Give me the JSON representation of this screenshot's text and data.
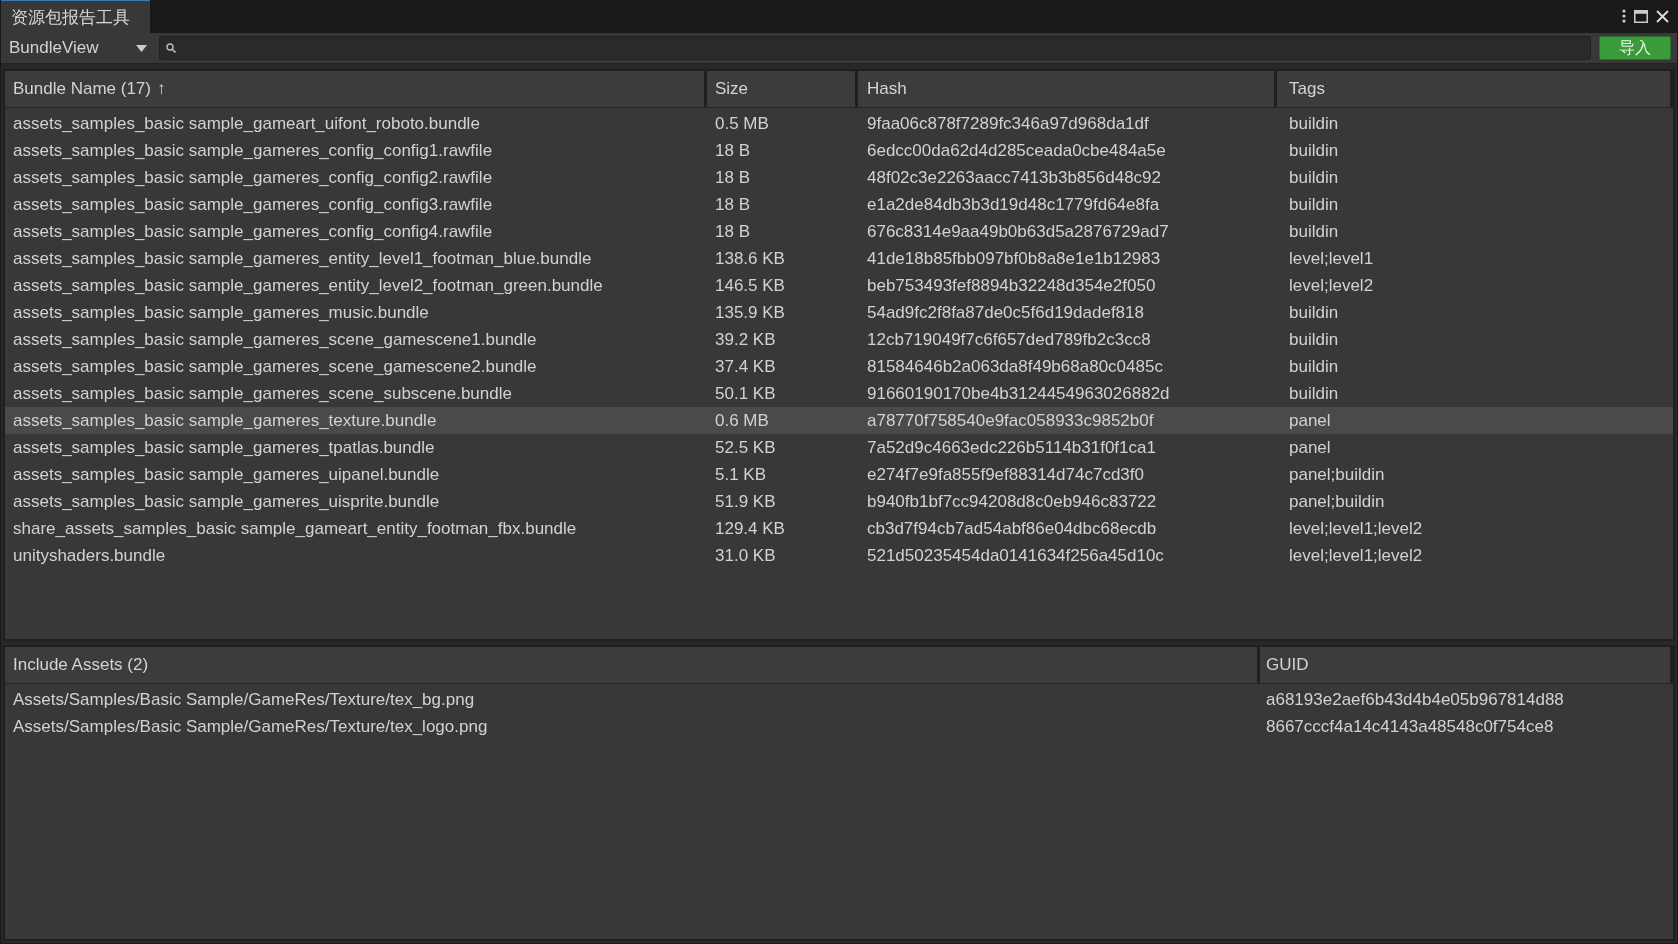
{
  "window": {
    "title": "资源包报告工具"
  },
  "toolbar": {
    "view_dropdown": "BundleView",
    "import_button": "导入"
  },
  "bundle_table": {
    "columns": [
      {
        "label": "Bundle Name (17)",
        "sort_indicator": "↑"
      },
      {
        "label": "Size"
      },
      {
        "label": "Hash"
      },
      {
        "label": "Tags"
      }
    ],
    "rows": [
      {
        "name": "assets_samples_basic sample_gameart_uifont_roboto.bundle",
        "size": "0.5 MB",
        "hash": "9faa06c878f7289fc346a97d968da1df",
        "tags": "buildin",
        "selected": false
      },
      {
        "name": "assets_samples_basic sample_gameres_config_config1.rawfile",
        "size": "18 B",
        "hash": "6edcc00da62d4d285ceada0cbe484a5e",
        "tags": "buildin",
        "selected": false
      },
      {
        "name": "assets_samples_basic sample_gameres_config_config2.rawfile",
        "size": "18 B",
        "hash": "48f02c3e2263aacc7413b3b856d48c92",
        "tags": "buildin",
        "selected": false
      },
      {
        "name": "assets_samples_basic sample_gameres_config_config3.rawfile",
        "size": "18 B",
        "hash": "e1a2de84db3b3d19d48c1779fd64e8fa",
        "tags": "buildin",
        "selected": false
      },
      {
        "name": "assets_samples_basic sample_gameres_config_config4.rawfile",
        "size": "18 B",
        "hash": "676c8314e9aa49b0b63d5a2876729ad7",
        "tags": "buildin",
        "selected": false
      },
      {
        "name": "assets_samples_basic sample_gameres_entity_level1_footman_blue.bundle",
        "size": "138.6 KB",
        "hash": "41de18b85fbb097bf0b8a8e1e1b12983",
        "tags": "level;level1",
        "selected": false
      },
      {
        "name": "assets_samples_basic sample_gameres_entity_level2_footman_green.bundle",
        "size": "146.5 KB",
        "hash": "beb753493fef8894b32248d354e2f050",
        "tags": "level;level2",
        "selected": false
      },
      {
        "name": "assets_samples_basic sample_gameres_music.bundle",
        "size": "135.9 KB",
        "hash": "54ad9fc2f8fa87de0c5f6d19dadef818",
        "tags": "buildin",
        "selected": false
      },
      {
        "name": "assets_samples_basic sample_gameres_scene_gamescene1.bundle",
        "size": "39.2 KB",
        "hash": "12cb719049f7c6f657ded789fb2c3cc8",
        "tags": "buildin",
        "selected": false
      },
      {
        "name": "assets_samples_basic sample_gameres_scene_gamescene2.bundle",
        "size": "37.4 KB",
        "hash": "81584646b2a063da8f49b68a80c0485c",
        "tags": "buildin",
        "selected": false
      },
      {
        "name": "assets_samples_basic sample_gameres_scene_subscene.bundle",
        "size": "50.1 KB",
        "hash": "91660190170be4b3124454963026882d",
        "tags": "buildin",
        "selected": false
      },
      {
        "name": "assets_samples_basic sample_gameres_texture.bundle",
        "size": "0.6 MB",
        "hash": "a78770f758540e9fac058933c9852b0f",
        "tags": "panel",
        "selected": true
      },
      {
        "name": "assets_samples_basic sample_gameres_tpatlas.bundle",
        "size": "52.5 KB",
        "hash": "7a52d9c4663edc226b5114b31f0f1ca1",
        "tags": "panel",
        "selected": false
      },
      {
        "name": "assets_samples_basic sample_gameres_uipanel.bundle",
        "size": "5.1 KB",
        "hash": "e274f7e9fa855f9ef88314d74c7cd3f0",
        "tags": "panel;buildin",
        "selected": false
      },
      {
        "name": "assets_samples_basic sample_gameres_uisprite.bundle",
        "size": "51.9 KB",
        "hash": "b940fb1bf7cc94208d8c0eb946c83722",
        "tags": "panel;buildin",
        "selected": false
      },
      {
        "name": "share_assets_samples_basic sample_gameart_entity_footman_fbx.bundle",
        "size": "129.4 KB",
        "hash": "cb3d7f94cb7ad54abf86e04dbc68ecdb",
        "tags": "level;level1;level2",
        "selected": false
      },
      {
        "name": "unityshaders.bundle",
        "size": "31.0 KB",
        "hash": "521d50235454da0141634f256a45d10c",
        "tags": "level;level1;level2",
        "selected": false
      }
    ]
  },
  "assets_table": {
    "columns": [
      {
        "label": "Include Assets (2)"
      },
      {
        "label": "GUID"
      }
    ],
    "rows": [
      {
        "path": "Assets/Samples/Basic Sample/GameRes/Texture/tex_bg.png",
        "guid": "a68193e2aef6b43d4b4e05b967814d88"
      },
      {
        "path": "Assets/Samples/Basic Sample/GameRes/Texture/tex_logo.png",
        "guid": "8667cccf4a14c4143a48548c0f754ce8"
      }
    ]
  }
}
